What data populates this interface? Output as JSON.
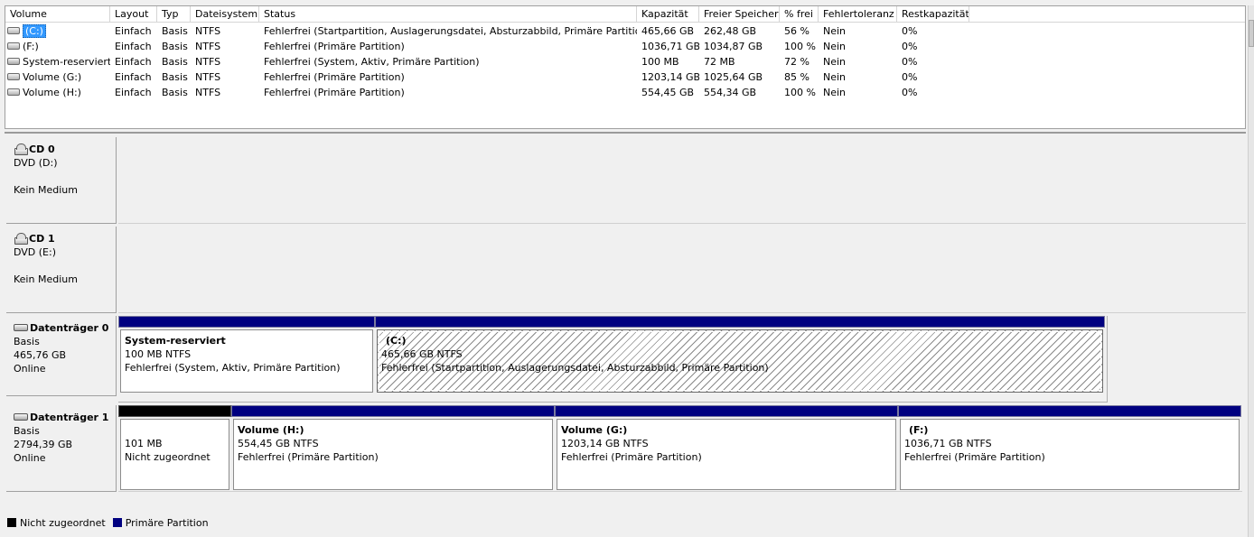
{
  "columns": [
    "Volume",
    "Layout",
    "Typ",
    "Dateisystem",
    "Status",
    "Kapazität",
    "Freier Speicher",
    "% frei",
    "Fehlertoleranz",
    "Restkapazität"
  ],
  "volumes": [
    {
      "name": "(C:)",
      "layout": "Einfach",
      "typ": "Basis",
      "fs": "NTFS",
      "status": "Fehlerfrei (Startpartition, Auslagerungsdatei, Absturzabbild, Primäre Partition)",
      "capacity": "465,66 GB",
      "free": "262,48 GB",
      "pct": "56 %",
      "fault": "Nein",
      "rest": "0%",
      "selected": true
    },
    {
      "name": "(F:)",
      "layout": "Einfach",
      "typ": "Basis",
      "fs": "NTFS",
      "status": "Fehlerfrei (Primäre Partition)",
      "capacity": "1036,71 GB",
      "free": "1034,87 GB",
      "pct": "100 %",
      "fault": "Nein",
      "rest": "0%"
    },
    {
      "name": "System-reserviert",
      "layout": "Einfach",
      "typ": "Basis",
      "fs": "NTFS",
      "status": "Fehlerfrei (System, Aktiv, Primäre Partition)",
      "capacity": "100 MB",
      "free": "72 MB",
      "pct": "72 %",
      "fault": "Nein",
      "rest": "0%"
    },
    {
      "name": "Volume (G:)",
      "layout": "Einfach",
      "typ": "Basis",
      "fs": "NTFS",
      "status": "Fehlerfrei (Primäre Partition)",
      "capacity": "1203,14 GB",
      "free": "1025,64 GB",
      "pct": "85 %",
      "fault": "Nein",
      "rest": "0%"
    },
    {
      "name": "Volume (H:)",
      "layout": "Einfach",
      "typ": "Basis",
      "fs": "NTFS",
      "status": "Fehlerfrei (Primäre Partition)",
      "capacity": "554,45 GB",
      "free": "554,34 GB",
      "pct": "100 %",
      "fault": "Nein",
      "rest": "0%"
    }
  ],
  "disks": [
    {
      "kind": "cd",
      "title": "CD 0",
      "lines": [
        "DVD (D:)",
        "",
        "Kein Medium"
      ],
      "partitions": []
    },
    {
      "kind": "cd",
      "title": "CD 1",
      "lines": [
        "DVD (E:)",
        "",
        "Kein Medium"
      ],
      "partitions": []
    },
    {
      "kind": "hdd",
      "title": "Datenträger 0",
      "lines": [
        "Basis",
        "465,76 GB",
        "Online"
      ],
      "partitions": [
        {
          "title": "System-reserviert",
          "size": "100 MB NTFS",
          "status": "Fehlerfrei (System, Aktiv, Primäre Partition)",
          "bar": "primary"
        },
        {
          "title": "(C:)",
          "size": "465,66 GB NTFS",
          "status": "Fehlerfrei (Startpartition, Auslagerungsdatei, Absturzabbild, Primäre Partition)",
          "bar": "primary",
          "hatched": true
        }
      ]
    },
    {
      "kind": "hdd",
      "title": "Datenträger 1",
      "lines": [
        "Basis",
        "2794,39 GB",
        "Online"
      ],
      "partitions": [
        {
          "title": "",
          "size": "101 MB",
          "status": "Nicht zugeordnet",
          "bar": "unallocated"
        },
        {
          "title": "Volume  (H:)",
          "size": "554,45 GB NTFS",
          "status": "Fehlerfrei (Primäre Partition)",
          "bar": "primary"
        },
        {
          "title": "Volume  (G:)",
          "size": "1203,14 GB NTFS",
          "status": "Fehlerfrei (Primäre Partition)",
          "bar": "primary"
        },
        {
          "title": "(F:)",
          "size": "1036,71 GB NTFS",
          "status": "Fehlerfrei (Primäre Partition)",
          "bar": "primary"
        }
      ]
    }
  ],
  "legend": [
    {
      "label": "Nicht zugeordnet",
      "color": "#000000"
    },
    {
      "label": "Primäre Partition",
      "color": "#000080"
    }
  ]
}
